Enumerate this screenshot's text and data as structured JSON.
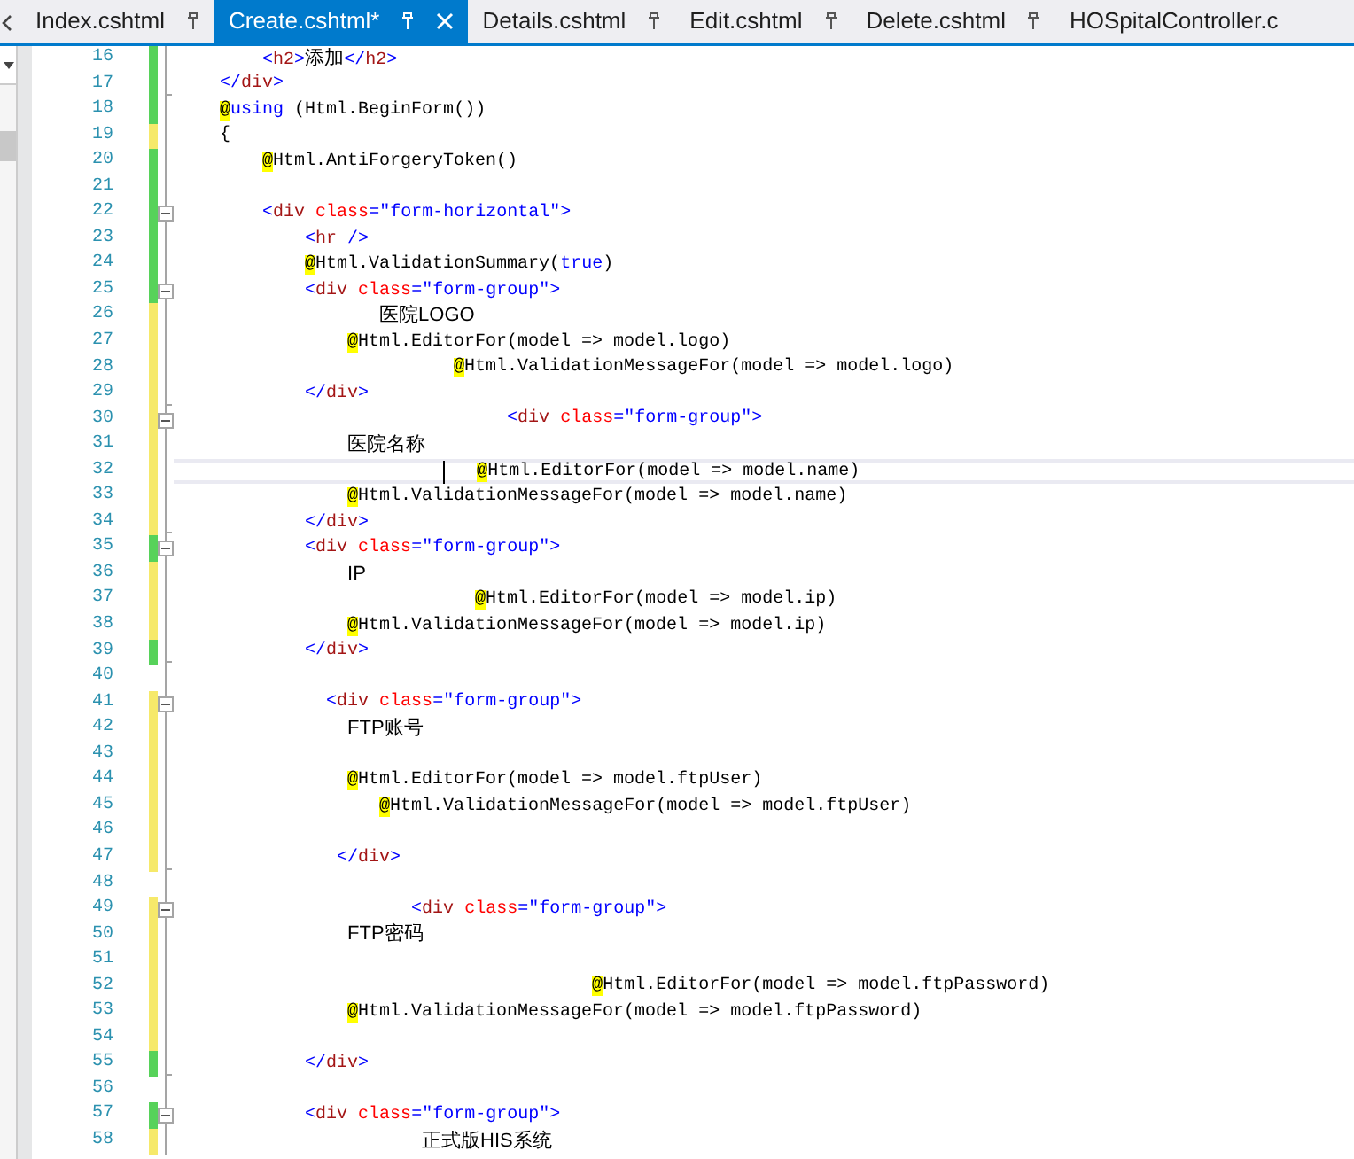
{
  "tabs": [
    {
      "label": "Index.cshtml",
      "selected": false,
      "pin": true,
      "close_button": false
    },
    {
      "label": "Create.cshtml*",
      "selected": true,
      "pin": true,
      "close_button": true
    },
    {
      "label": "Details.cshtml",
      "selected": false,
      "pin": true,
      "close_button": false
    },
    {
      "label": "Edit.cshtml",
      "selected": false,
      "pin": true,
      "close_button": false
    },
    {
      "label": "Delete.cshtml",
      "selected": false,
      "pin": true,
      "close_button": false
    },
    {
      "label": "HOSpitalController.c",
      "selected": false,
      "pin": false,
      "close_button": false
    }
  ],
  "lines": [
    {
      "number": "16",
      "color": "#57d25a",
      "collapsible": false,
      "fold_end": false,
      "current": false,
      "tokens": [
        {
          "kind": "delim",
          "text": "        <"
        },
        {
          "kind": "tag",
          "text": "h2"
        },
        {
          "kind": "delim",
          "text": ">"
        },
        {
          "kind": "text",
          "text": "添加"
        },
        {
          "kind": "delim",
          "text": "</"
        },
        {
          "kind": "tag",
          "text": "h2"
        },
        {
          "kind": "delim",
          "text": ">"
        }
      ]
    },
    {
      "number": "17",
      "color": "#57d25a",
      "collapsible": false,
      "fold_end": true,
      "current": false,
      "tokens": [
        {
          "kind": "delim",
          "text": "    </"
        },
        {
          "kind": "tag",
          "text": "div"
        },
        {
          "kind": "delim",
          "text": ">"
        }
      ]
    },
    {
      "number": "18",
      "color": "#57d25a",
      "collapsible": false,
      "fold_end": false,
      "current": false,
      "tokens": [
        {
          "kind": "razor",
          "text": "    @"
        },
        {
          "kind": "keyword",
          "text": "using"
        },
        {
          "kind": "code",
          "text": " (Html.BeginForm())"
        }
      ]
    },
    {
      "number": "19",
      "color": "#f6e96a",
      "collapsible": false,
      "fold_end": false,
      "current": false,
      "tokens": [
        {
          "kind": "code",
          "text": "    {"
        }
      ]
    },
    {
      "number": "20",
      "color": "#57d25a",
      "collapsible": false,
      "fold_end": false,
      "current": false,
      "tokens": [
        {
          "kind": "razor",
          "text": "        @"
        },
        {
          "kind": "code",
          "text": "Html.AntiForgeryToken()"
        }
      ]
    },
    {
      "number": "21",
      "color": "#57d25a",
      "collapsible": false,
      "fold_end": false,
      "current": false
    },
    {
      "number": "22",
      "color": "#57d25a",
      "collapsible": true,
      "fold_end": false,
      "current": false,
      "tokens": [
        {
          "kind": "delim",
          "text": "        <"
        },
        {
          "kind": "tag",
          "text": "div"
        },
        {
          "kind": "attr",
          "text": " class"
        },
        {
          "kind": "delim",
          "text": "="
        },
        {
          "kind": "value",
          "text": "\"form-horizontal\""
        },
        {
          "kind": "delim",
          "text": ">"
        }
      ]
    },
    {
      "number": "23",
      "color": "#57d25a",
      "collapsible": false,
      "fold_end": false,
      "current": false,
      "tokens": [
        {
          "kind": "delim",
          "text": "            <"
        },
        {
          "kind": "tag",
          "text": "hr"
        },
        {
          "kind": "delim",
          "text": " />"
        }
      ]
    },
    {
      "number": "24",
      "color": "#57d25a",
      "collapsible": false,
      "fold_end": false,
      "current": false,
      "tokens": [
        {
          "kind": "razor",
          "text": "            @"
        },
        {
          "kind": "code",
          "text": "Html.ValidationSummary("
        },
        {
          "kind": "keyword",
          "text": "true"
        },
        {
          "kind": "code",
          "text": ")"
        }
      ]
    },
    {
      "number": "25",
      "color": "#57d25a",
      "collapsible": true,
      "fold_end": false,
      "current": false,
      "tokens": [
        {
          "kind": "delim",
          "text": "            <"
        },
        {
          "kind": "tag",
          "text": "div"
        },
        {
          "kind": "attr",
          "text": " class"
        },
        {
          "kind": "delim",
          "text": "="
        },
        {
          "kind": "value",
          "text": "\"form-group\""
        },
        {
          "kind": "delim",
          "text": ">"
        }
      ]
    },
    {
      "number": "26",
      "color": "#f6e96a",
      "collapsible": false,
      "fold_end": false,
      "current": false,
      "tokens": [
        {
          "kind": "text",
          "text": "                   医院LOGO"
        }
      ]
    },
    {
      "number": "27",
      "color": "#f6e96a",
      "collapsible": false,
      "fold_end": false,
      "current": false,
      "tokens": [
        {
          "kind": "razor",
          "text": "                @"
        },
        {
          "kind": "code",
          "text": "Html.EditorFor(model => model.logo)"
        }
      ]
    },
    {
      "number": "28",
      "color": "#f6e96a",
      "collapsible": false,
      "fold_end": false,
      "current": false,
      "tokens": [
        {
          "kind": "razor",
          "text": "                          @"
        },
        {
          "kind": "code",
          "text": "Html.ValidationMessageFor(model => model.logo)"
        }
      ]
    },
    {
      "number": "29",
      "color": "#f6e96a",
      "collapsible": false,
      "fold_end": true,
      "current": false,
      "tokens": [
        {
          "kind": "delim",
          "text": "            </"
        },
        {
          "kind": "tag",
          "text": "div"
        },
        {
          "kind": "delim",
          "text": ">"
        }
      ]
    },
    {
      "number": "30",
      "color": "#f6e96a",
      "collapsible": true,
      "fold_end": false,
      "current": false,
      "tokens": [
        {
          "kind": "delim",
          "text": "                               <"
        },
        {
          "kind": "tag",
          "text": "div"
        },
        {
          "kind": "attr",
          "text": " class"
        },
        {
          "kind": "delim",
          "text": "="
        },
        {
          "kind": "value",
          "text": "\"form-group\""
        },
        {
          "kind": "delim",
          "text": ">"
        }
      ]
    },
    {
      "number": "31",
      "color": "#f6e96a",
      "collapsible": false,
      "fold_end": false,
      "current": false,
      "tokens": [
        {
          "kind": "text",
          "text": "                医院名称"
        }
      ]
    },
    {
      "number": "32",
      "color": "#f6e96a",
      "collapsible": false,
      "fold_end": false,
      "current": true,
      "tokens": [
        {
          "kind": "razor",
          "text": "                            @"
        },
        {
          "kind": "code",
          "text": "Html.EditorFor(model => model.name)"
        }
      ]
    },
    {
      "number": "33",
      "color": "#f6e96a",
      "collapsible": false,
      "fold_end": false,
      "current": false,
      "tokens": [
        {
          "kind": "razor",
          "text": "                @"
        },
        {
          "kind": "code",
          "text": "Html.ValidationMessageFor(model => model.name)"
        }
      ]
    },
    {
      "number": "34",
      "color": "#f6e96a",
      "collapsible": false,
      "fold_end": true,
      "current": false,
      "tokens": [
        {
          "kind": "delim",
          "text": "            </"
        },
        {
          "kind": "tag",
          "text": "div"
        },
        {
          "kind": "delim",
          "text": ">"
        }
      ]
    },
    {
      "number": "35",
      "color": "#57d25a",
      "collapsible": true,
      "fold_end": false,
      "current": false,
      "tokens": [
        {
          "kind": "delim",
          "text": "            <"
        },
        {
          "kind": "tag",
          "text": "div"
        },
        {
          "kind": "attr",
          "text": " class"
        },
        {
          "kind": "delim",
          "text": "="
        },
        {
          "kind": "value",
          "text": "\"form-group\""
        },
        {
          "kind": "delim",
          "text": ">"
        }
      ]
    },
    {
      "number": "36",
      "color": "#f6e96a",
      "collapsible": false,
      "fold_end": false,
      "current": false,
      "tokens": [
        {
          "kind": "text",
          "text": "                IP"
        }
      ]
    },
    {
      "number": "37",
      "color": "#f6e96a",
      "collapsible": false,
      "fold_end": false,
      "current": false,
      "tokens": [
        {
          "kind": "razor",
          "text": "                            @"
        },
        {
          "kind": "code",
          "text": "Html.EditorFor(model => model.ip)"
        }
      ]
    },
    {
      "number": "38",
      "color": "#f6e96a",
      "collapsible": false,
      "fold_end": false,
      "current": false,
      "tokens": [
        {
          "kind": "razor",
          "text": "                @"
        },
        {
          "kind": "code",
          "text": "Html.ValidationMessageFor(model => model.ip)"
        }
      ]
    },
    {
      "number": "39",
      "color": "#57d25a",
      "collapsible": false,
      "fold_end": true,
      "current": false,
      "tokens": [
        {
          "kind": "delim",
          "text": "            </"
        },
        {
          "kind": "tag",
          "text": "div"
        },
        {
          "kind": "delim",
          "text": ">"
        }
      ]
    },
    {
      "number": "40",
      "collapsible": false,
      "fold_end": false,
      "current": false
    },
    {
      "number": "41",
      "color": "#f6e96a",
      "collapsible": true,
      "fold_end": false,
      "current": false,
      "tokens": [
        {
          "kind": "delim",
          "text": "              <"
        },
        {
          "kind": "tag",
          "text": "div"
        },
        {
          "kind": "attr",
          "text": " class"
        },
        {
          "kind": "delim",
          "text": "="
        },
        {
          "kind": "value",
          "text": "\"form-group\""
        },
        {
          "kind": "delim",
          "text": ">"
        }
      ]
    },
    {
      "number": "42",
      "color": "#f6e96a",
      "collapsible": false,
      "fold_end": false,
      "current": false,
      "tokens": [
        {
          "kind": "text",
          "text": "                FTP账号"
        }
      ]
    },
    {
      "number": "43",
      "color": "#f6e96a",
      "collapsible": false,
      "fold_end": false,
      "current": false
    },
    {
      "number": "44",
      "color": "#f6e96a",
      "collapsible": false,
      "fold_end": false,
      "current": false,
      "tokens": [
        {
          "kind": "razor",
          "text": "                @"
        },
        {
          "kind": "code",
          "text": "Html.EditorFor(model => model.ftpUser)"
        }
      ]
    },
    {
      "number": "45",
      "color": "#f6e96a",
      "collapsible": false,
      "fold_end": false,
      "current": false,
      "tokens": [
        {
          "kind": "razor",
          "text": "                   @"
        },
        {
          "kind": "code",
          "text": "Html.ValidationMessageFor(model => model.ftpUser)"
        }
      ]
    },
    {
      "number": "46",
      "color": "#f6e96a",
      "collapsible": false,
      "fold_end": false,
      "current": false
    },
    {
      "number": "47",
      "color": "#f6e96a",
      "collapsible": false,
      "fold_end": true,
      "current": false,
      "tokens": [
        {
          "kind": "delim",
          "text": "               </"
        },
        {
          "kind": "tag",
          "text": "div"
        },
        {
          "kind": "delim",
          "text": ">"
        }
      ]
    },
    {
      "number": "48",
      "collapsible": false,
      "fold_end": false,
      "current": false
    },
    {
      "number": "49",
      "color": "#f6e96a",
      "collapsible": true,
      "fold_end": false,
      "current": false,
      "tokens": [
        {
          "kind": "delim",
          "text": "                      <"
        },
        {
          "kind": "tag",
          "text": "div"
        },
        {
          "kind": "attr",
          "text": " class"
        },
        {
          "kind": "delim",
          "text": "="
        },
        {
          "kind": "value",
          "text": "\"form-group\""
        },
        {
          "kind": "delim",
          "text": ">"
        }
      ]
    },
    {
      "number": "50",
      "color": "#f6e96a",
      "collapsible": false,
      "fold_end": false,
      "current": false,
      "tokens": [
        {
          "kind": "text",
          "text": "                FTP密码"
        }
      ]
    },
    {
      "number": "51",
      "color": "#f6e96a",
      "collapsible": false,
      "fold_end": false,
      "current": false
    },
    {
      "number": "52",
      "color": "#f6e96a",
      "collapsible": false,
      "fold_end": false,
      "current": false,
      "tokens": [
        {
          "kind": "razor",
          "text": "                                       @"
        },
        {
          "kind": "code",
          "text": "Html.EditorFor(model => model.ftpPassword)"
        }
      ]
    },
    {
      "number": "53",
      "color": "#f6e96a",
      "collapsible": false,
      "fold_end": false,
      "current": false,
      "tokens": [
        {
          "kind": "razor",
          "text": "                @"
        },
        {
          "kind": "code",
          "text": "Html.ValidationMessageFor(model => model.ftpPassword)"
        }
      ]
    },
    {
      "number": "54",
      "color": "#f6e96a",
      "collapsible": false,
      "fold_end": false,
      "current": false
    },
    {
      "number": "55",
      "color": "#57d25a",
      "collapsible": false,
      "fold_end": true,
      "current": false,
      "tokens": [
        {
          "kind": "delim",
          "text": "            </"
        },
        {
          "kind": "tag",
          "text": "div"
        },
        {
          "kind": "delim",
          "text": ">"
        }
      ]
    },
    {
      "number": "56",
      "collapsible": false,
      "fold_end": false,
      "current": false
    },
    {
      "number": "57",
      "color": "#57d25a",
      "collapsible": true,
      "fold_end": false,
      "current": false,
      "tokens": [
        {
          "kind": "delim",
          "text": "            <"
        },
        {
          "kind": "tag",
          "text": "div"
        },
        {
          "kind": "attr",
          "text": " class"
        },
        {
          "kind": "delim",
          "text": "="
        },
        {
          "kind": "value",
          "text": "\"form-group\""
        },
        {
          "kind": "delim",
          "text": ">"
        }
      ]
    },
    {
      "number": "58",
      "color": "#f6e96a",
      "collapsible": false,
      "fold_end": false,
      "current": false,
      "tokens": [
        {
          "kind": "text",
          "text": "                       正式版HIS系统"
        }
      ]
    }
  ]
}
